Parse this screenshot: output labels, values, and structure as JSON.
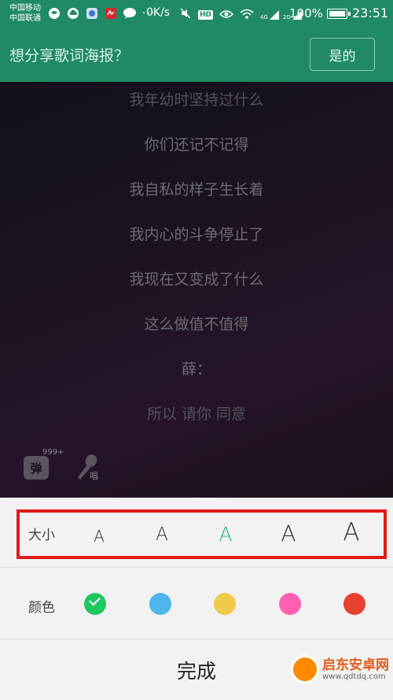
{
  "status_bar": {
    "carrier_1": "中国移动",
    "carrier_2": "中国联通",
    "speed": "0K/s",
    "battery": "100%",
    "time": "23:51",
    "signal_1": "4G",
    "signal_2": "2G",
    "hd": "HD",
    "left_icons": [
      "globe-icon",
      "cloud-icon",
      "app-icon",
      "netease-icon",
      "chat-icon",
      "more-icon"
    ],
    "right_icons": [
      "mute-icon",
      "hd-icon",
      "eye-icon",
      "wifi-icon",
      "signal-icon"
    ]
  },
  "share_bar": {
    "title": "想分享歌词海报？",
    "confirm_label": "是的"
  },
  "lyrics": [
    "我年幼时坚持过什么",
    "你们还记不记得",
    "我自私的样子生长着",
    "我内心的斗争停止了",
    "我现在又变成了什么",
    "这么做值不值得",
    "薛：",
    "所以 请你 同意"
  ],
  "controls": {
    "danmu_label": "弹",
    "danmu_count": "999+",
    "sing_label": "唱"
  },
  "size_row": {
    "label": "大小",
    "options": [
      "A",
      "A",
      "A",
      "A",
      "A"
    ],
    "selected_index": 2,
    "highlight_color": "#e31a1a"
  },
  "color_row": {
    "label": "颜色",
    "colors": [
      "#1ec760",
      "#4db6ec",
      "#f0cb4a",
      "#ff5fb0",
      "#e8412f"
    ],
    "selected_index": 0
  },
  "done_label": "完成",
  "watermark": {
    "title": "启东安卓网",
    "url": "www.qdtdq.com"
  }
}
